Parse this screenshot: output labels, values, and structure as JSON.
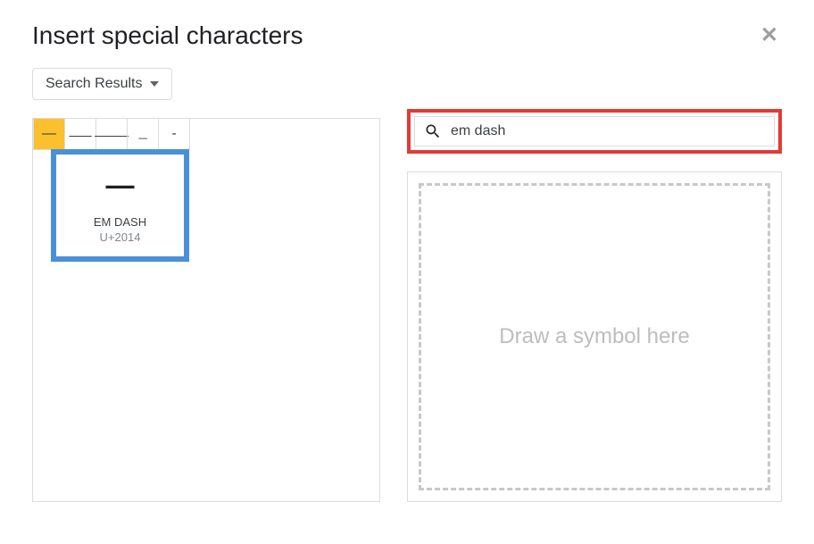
{
  "dialog": {
    "title": "Insert special characters"
  },
  "dropdown": {
    "label": "Search Results"
  },
  "search": {
    "value": "em dash"
  },
  "results": [
    {
      "glyph": "—"
    },
    {
      "glyph": "⸺"
    },
    {
      "glyph": "⸻"
    },
    {
      "glyph": "﹘"
    },
    {
      "glyph": "-"
    }
  ],
  "preview": {
    "glyph": "—",
    "name": "EM DASH",
    "code": "U+2014"
  },
  "draw": {
    "placeholder": "Draw a symbol here"
  }
}
